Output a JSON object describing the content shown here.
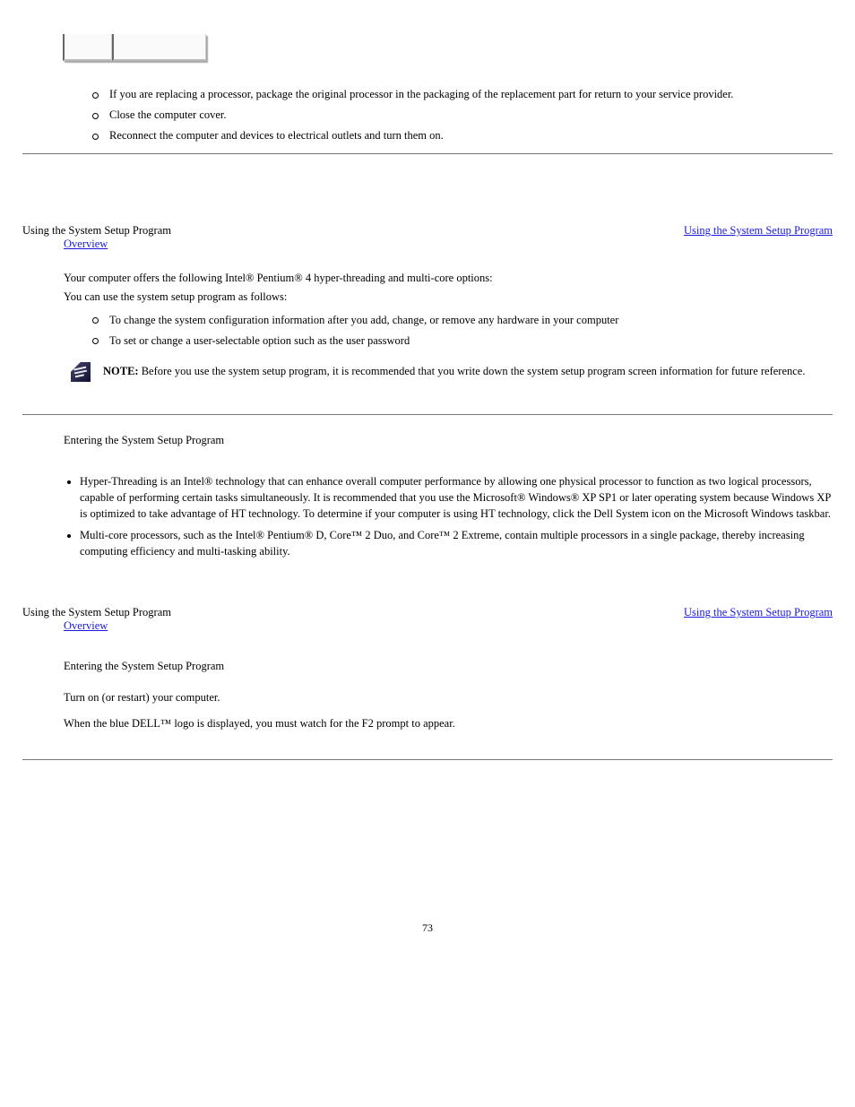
{
  "top_list": {
    "items": [
      "If you are replacing a processor, package the original processor in the packaging of the replacement part for return to your service provider.",
      "Close the computer cover.",
      "Reconnect the computer and devices to electrical outlets and turn them on."
    ]
  },
  "section1": {
    "para_lead": "Using the System Setup Program",
    "para_link": "Using the System Setup Program",
    "sub_link": "Overview",
    "body1": "Your computer offers the following Intel® Pentium® 4 hyper-threading and multi-core options:",
    "body2": "You can use the system setup program as follows:",
    "bullets": [
      "To change the system configuration information after you add, change, or remove any hardware in your computer",
      "To set or change a user-selectable option such as the user password"
    ],
    "note_label": "NOTE:",
    "note_text": " Before you use the system setup program, it is recommended that you write down the system setup program screen information for future reference."
  },
  "section2": {
    "para_lead": "Entering the System Setup Program",
    "bullets": [
      "Hyper-Threading is an Intel® technology that can enhance overall computer performance by allowing one physical processor to function as two logical processors, capable of performing certain tasks simultaneously. It is recommended that you use the Microsoft® Windows® XP SP1 or later operating system because Windows XP is optimized to take advantage of HT technology. To determine if your computer is using HT technology, click the Dell System icon on the Microsoft Windows taskbar.",
      "Multi-core processors, such as the Intel® Pentium® D, Core™ 2 Duo, and Core™ 2 Extreme, contain multiple processors in a single package, thereby increasing computing efficiency and multi-tasking ability."
    ],
    "para_lead2": "Using the System Setup Program",
    "para_link2": "Using the System Setup Program",
    "sub_link2": "Overview",
    "step_title": "Entering the System Setup Program",
    "steps": [
      "Turn on (or restart) your computer.",
      "When the blue DELL™ logo is displayed, you must watch for the F2 prompt to appear."
    ]
  },
  "page_number": "73"
}
